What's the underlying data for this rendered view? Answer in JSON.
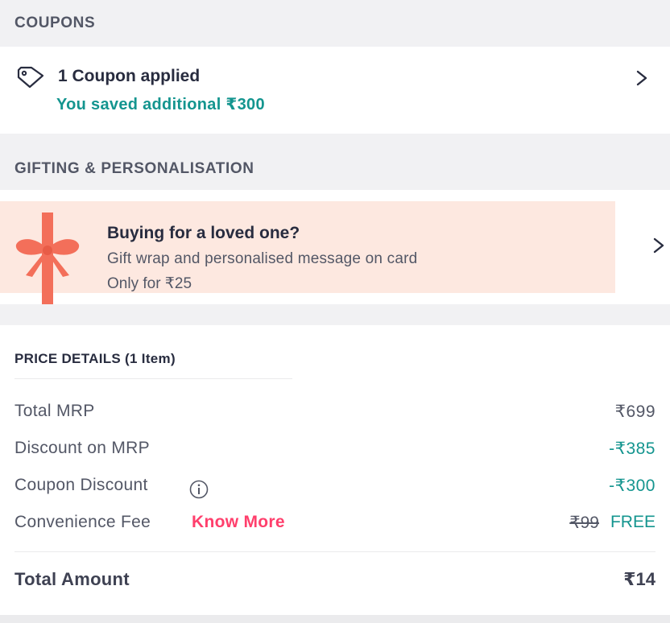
{
  "coupons": {
    "header": "COUPONS",
    "title": "1 Coupon applied",
    "saved_text": "You saved additional ₹300",
    "icon": "tag-icon",
    "chevron": "chevron-right-icon"
  },
  "gifting": {
    "header": "GIFTING & PERSONALISATION",
    "title": "Buying for a loved one?",
    "subtitle": "Gift wrap and personalised message on card",
    "price": "Only for ₹25",
    "icon": "gift-ribbon-icon",
    "chevron": "chevron-right-icon",
    "banner_color": "#fde8e0",
    "ribbon_color": "#f36f5a"
  },
  "price_details": {
    "header": "PRICE DETAILS (1 Item)",
    "rows": [
      {
        "label": "Total MRP",
        "value": "₹699"
      },
      {
        "label": "Discount on MRP",
        "value": "-₹385"
      },
      {
        "label": "Coupon Discount",
        "value": "-₹300"
      },
      {
        "label": "Convenience Fee",
        "link": "Know More",
        "original": "₹99",
        "value": "FREE"
      }
    ],
    "total": {
      "label": "Total Amount",
      "value": "₹14"
    }
  },
  "colors": {
    "teal": "#14958f",
    "pink": "#ff3f6c",
    "text": "#282c3f",
    "muted": "#535766"
  }
}
